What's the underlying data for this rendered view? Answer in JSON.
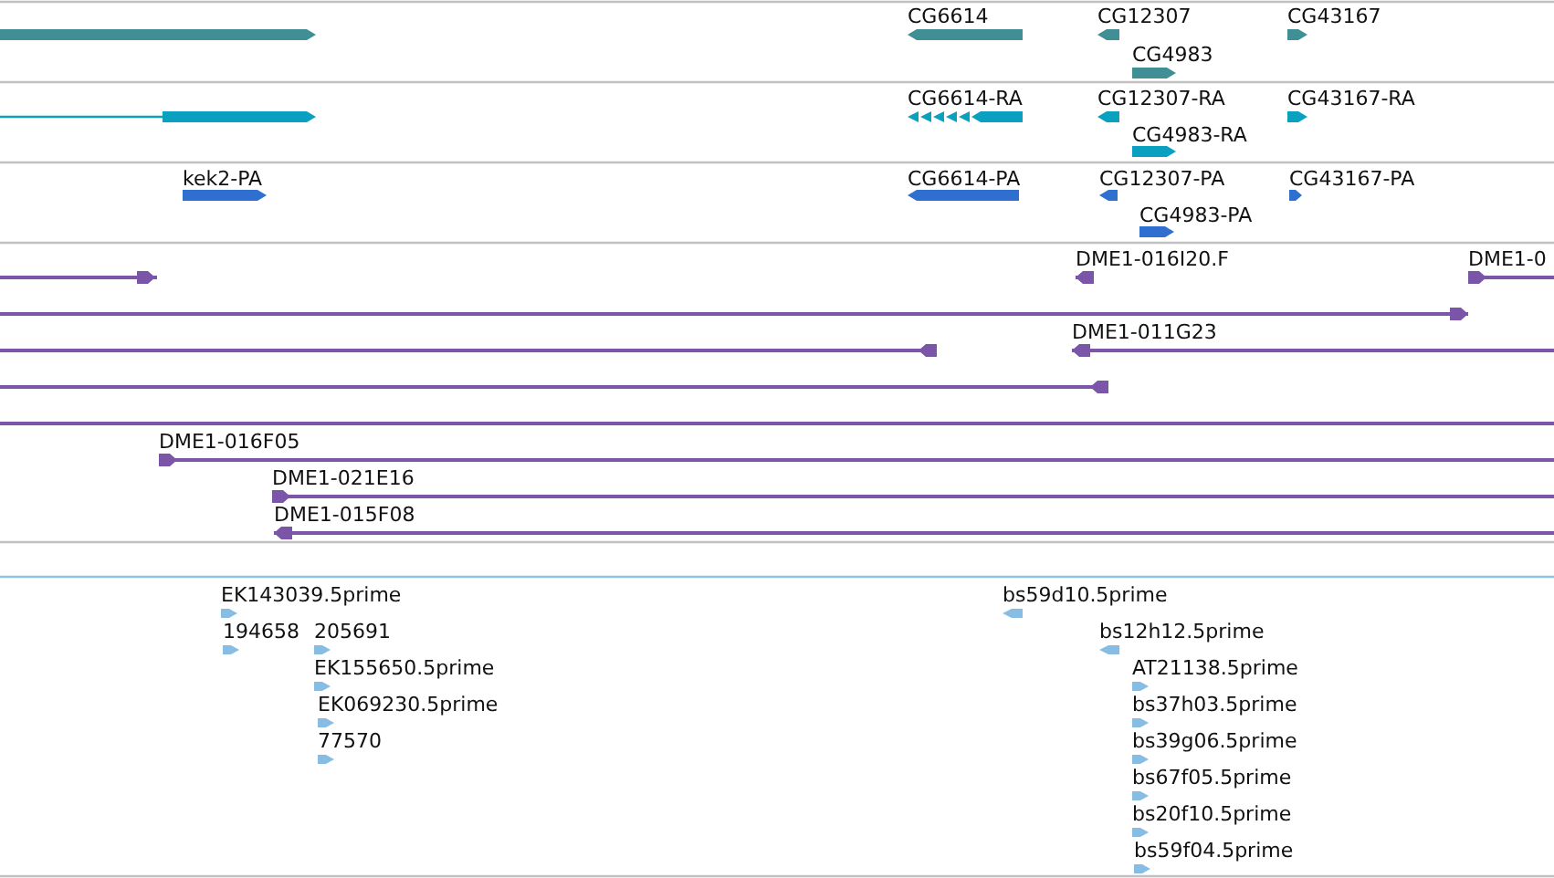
{
  "tracks": [
    {
      "kind": "gene",
      "color": "#3f8f94",
      "features": [
        {
          "reverse": false
        },
        {
          "label": "CG6614",
          "reverse": true
        },
        {
          "label": "CG12307",
          "reverse": true
        },
        {
          "label": "CG43167",
          "reverse": false
        },
        {
          "label": "CG4983",
          "reverse": false
        }
      ]
    },
    {
      "kind": "transcript",
      "color": "#0aa0c0",
      "features": [
        {
          "reverse": false
        },
        {
          "label": "CG6614-RA",
          "reverse": true
        },
        {
          "label": "CG12307-RA",
          "reverse": true
        },
        {
          "label": "CG43167-RA",
          "reverse": false
        },
        {
          "label": "CG4983-RA",
          "reverse": false
        }
      ]
    },
    {
      "kind": "gene",
      "color": "#2f6fcf",
      "features": [
        {
          "label": "kek2-PA",
          "reverse": false
        },
        {
          "label": "CG6614-PA",
          "reverse": true
        },
        {
          "label": "CG12307-PA",
          "reverse": true
        },
        {
          "label": "CG43167-PA",
          "reverse": false
        },
        {
          "label": "CG4983-PA",
          "reverse": false
        }
      ]
    },
    {
      "kind": "clone",
      "color": "#7a55a8",
      "features": [
        {
          "kind": "arrow",
          "reverse": false
        },
        {
          "kind": "arrow",
          "label": "DME1-016I20.F",
          "reverse": true
        },
        {
          "kind": "arrow",
          "label": "DME1-0",
          "reverse": false
        },
        {
          "kind": "arrow",
          "reverse": false
        },
        {
          "kind": "arrow",
          "reverse": true
        },
        {
          "kind": "arrow",
          "label": "DME1-011G23",
          "reverse": true
        },
        {
          "kind": "arrow",
          "reverse": true
        },
        {
          "kind": "line"
        },
        {
          "kind": "arrow",
          "label": "DME1-016F05",
          "reverse": false
        },
        {
          "kind": "arrow",
          "label": "DME1-021E16",
          "reverse": false
        },
        {
          "kind": "arrow",
          "label": "DME1-015F08",
          "reverse": true
        }
      ]
    },
    {
      "kind": "est",
      "color": "#88bde3",
      "features": [
        {
          "label": "EK143039.5prime",
          "reverse": false
        },
        {
          "label": "194658",
          "reverse": false
        },
        {
          "label": "205691",
          "reverse": false
        },
        {
          "label": "EK155650.5prime",
          "reverse": false
        },
        {
          "label": "EK069230.5prime",
          "reverse": false
        },
        {
          "label": "77570",
          "reverse": false
        },
        {
          "label": "bs59d10.5prime",
          "reverse": true
        },
        {
          "label": "bs12h12.5prime",
          "reverse": true
        },
        {
          "label": "AT21138.5prime",
          "reverse": false
        },
        {
          "label": "bs37h03.5prime",
          "reverse": false
        },
        {
          "label": "bs39g06.5prime",
          "reverse": false
        },
        {
          "label": "bs67f05.5prime",
          "reverse": false
        },
        {
          "label": "bs20f10.5prime",
          "reverse": false
        },
        {
          "label": "bs59f04.5prime",
          "reverse": false
        }
      ]
    }
  ]
}
